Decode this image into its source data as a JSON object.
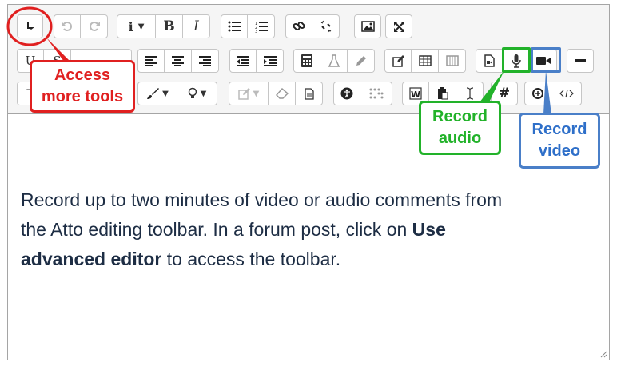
{
  "toolbar": {
    "row1": [
      {
        "name": "toggle-more-tools-button",
        "icon": "↓",
        "dim": false
      },
      {
        "name": "undo-button",
        "icon": "↶",
        "dim": true
      },
      {
        "name": "redo-button",
        "icon": "↷",
        "dim": true
      },
      {
        "name": "paragraph-styles-button",
        "icon": "i ▾",
        "dim": false
      },
      {
        "name": "bold-button",
        "icon": "B",
        "dim": false
      },
      {
        "name": "italic-button",
        "icon": "I",
        "dim": false
      },
      {
        "name": "unordered-list-button",
        "icon": "☰",
        "dim": false
      },
      {
        "name": "ordered-list-button",
        "icon": "☷",
        "dim": false
      },
      {
        "name": "link-button",
        "icon": "⛓",
        "dim": false
      },
      {
        "name": "unlink-button",
        "icon": "✂",
        "dim": false
      },
      {
        "name": "insert-image-button",
        "icon": "🖼",
        "dim": false
      },
      {
        "name": "fullscreen-button",
        "icon": "✥",
        "dim": false
      }
    ],
    "row2_labels": {
      "underline": "U",
      "strike": "S"
    },
    "row3_labels": {
      "text": "T",
      "hash": "#"
    }
  },
  "content": {
    "line1": "Record up to two minutes of video or audio comments from",
    "line2_start": "the Atto editing toolbar. In a forum post, click on ",
    "bold1": "Use",
    "bold2": "advanced editor",
    "line3_end": " to access the toolbar."
  },
  "callouts": {
    "more_tools_line1": "Access",
    "more_tools_line2": "more tools",
    "audio_line1": "Record",
    "audio_line2": "audio",
    "video_line1": "Record",
    "video_line2": "video"
  },
  "colors": {
    "red": "#e02020",
    "green": "#22b22a",
    "blue": "#4a7fc8",
    "text": "#1d2d44"
  }
}
